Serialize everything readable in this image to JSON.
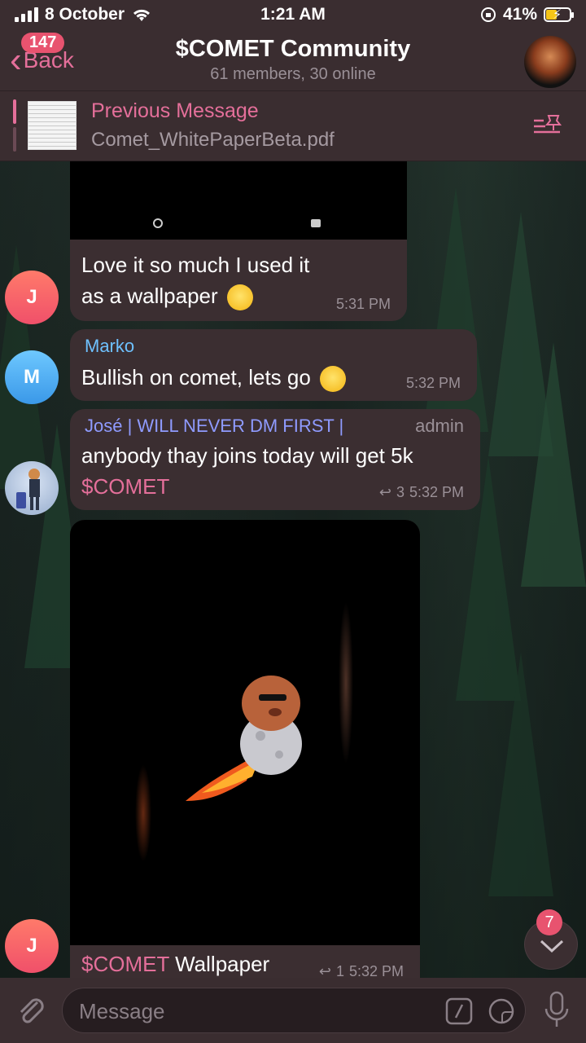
{
  "status_bar": {
    "carrier_date": "8 October",
    "time": "1:21 AM",
    "battery": "41%"
  },
  "header": {
    "back_label": "Back",
    "unread_count": "147",
    "title": "$COMET Community",
    "subtitle": "61 members, 30 online"
  },
  "pinned": {
    "title": "Previous Message",
    "text": "Comet_WhitePaperBeta.pdf"
  },
  "messages": [
    {
      "text": "Love it so much I used it as a wallpaper",
      "time": "5:31 PM",
      "avatar_initial": "J"
    },
    {
      "sender": "Marko",
      "text": "Bullish on comet, lets go",
      "time": "5:32 PM",
      "avatar_initial": "M"
    },
    {
      "sender": "José | WILL NEVER DM FIRST |",
      "role": "admin",
      "text": "anybody thay joins today will get 5k",
      "highlight": "$COMET",
      "reply_count": "3",
      "time": "5:32 PM"
    },
    {
      "caption_highlight": "$COMET",
      "caption": "Wallpaper",
      "reply_count": "1",
      "time": "5:32 PM",
      "avatar_initial": "J"
    }
  ],
  "scroll_badge": "7",
  "input": {
    "placeholder": "Message"
  },
  "colors": {
    "accent": "#e46f9a",
    "bubble": "#3b2e31",
    "bar": "#3a2d30"
  }
}
